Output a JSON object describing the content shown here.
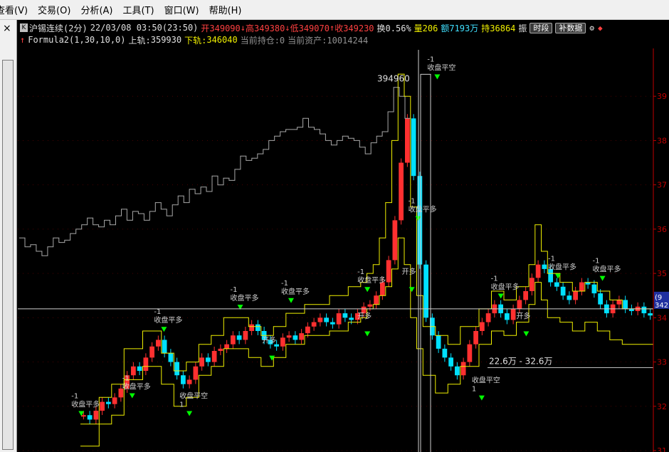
{
  "menu": [
    "查看(V)",
    "交易(O)",
    "分析(A)",
    "工具(T)",
    "窗口(W)",
    "帮助(H)"
  ],
  "left_panel": {
    "close_glyph": "×"
  },
  "info": {
    "badge": "K",
    "title": "沪锡连续(2分)",
    "datetime": "22/03/08 03:50(23:50)",
    "open": "开349090",
    "high": "高349380",
    "low": "低349070",
    "close": "收349230",
    "turnover": "换0.56%",
    "volume": "量206",
    "amount": "额7193万",
    "open_interest": "持36864",
    "amplitude": "振",
    "btn_timeframe": "时段",
    "btn_fill": "补数据"
  },
  "formula": {
    "name": "Formula2(1,30,10,0)",
    "upper_label": "上轨:",
    "upper_value": "359930",
    "lower_label": "下轨:",
    "lower_value": "346040",
    "position": "当前持仓:0",
    "assets": "当前资产:10014244"
  },
  "colors": {
    "up": "#ff3030",
    "down": "#00e0ff",
    "signal": "#00ff00",
    "band": "#f0f000",
    "price_line": "#a8a8a8",
    "axis": "#c00000"
  },
  "chart_data": {
    "type": "line",
    "ylim": [
      310000,
      400000
    ],
    "y_ticks": [
      {
        "value": 390000,
        "label": "39"
      },
      {
        "value": 380000,
        "label": "38"
      },
      {
        "value": 370000,
        "label": "37"
      },
      {
        "value": 360000,
        "label": "36"
      },
      {
        "value": 350000,
        "label": "35"
      },
      {
        "value": 340000,
        "label": "34"
      },
      {
        "value": 330000,
        "label": "33"
      },
      {
        "value": 320000,
        "label": "32"
      },
      {
        "value": 310000,
        "label": "31"
      }
    ],
    "peak_label": "394960",
    "cursor_tag": {
      "value": 342000,
      "top": "(9",
      "bottom": "342"
    },
    "volume_note": "22.6万 - 32.6万",
    "series": [
      {
        "values": [
          358000,
          356000,
          356500,
          355000,
          354000,
          356000,
          358000,
          357000,
          357500,
          359000,
          360000,
          361000,
          362500,
          361000,
          360500,
          362000,
          361000,
          363000,
          364500,
          362000,
          364000,
          363500,
          362000,
          364000,
          366000,
          364500,
          363000,
          365500,
          367500,
          366000,
          369000,
          368000,
          369500,
          368500,
          372000,
          370000,
          371500,
          371000,
          373500,
          376500,
          375500,
          376000,
          377000,
          378000,
          380000,
          381000,
          382000,
          382500,
          382500,
          383000,
          385000,
          383000,
          382500,
          381500,
          380000,
          379000,
          380000,
          381000,
          380500,
          380000,
          378500,
          377000,
          379500,
          381000,
          382000,
          386500,
          392000,
          390000,
          385000
        ]
      },
      {
        "values": [
          318000,
          317000,
          319000,
          321000,
          320500,
          322000,
          324000,
          327000,
          329000,
          328000,
          331000,
          333500,
          335000,
          332000,
          330000,
          327000,
          325000,
          326000,
          329000,
          331000,
          330000,
          332500,
          333000,
          334000,
          336000,
          335000,
          337000,
          338500,
          337000,
          335000,
          334000,
          333500,
          335500,
          336000,
          335000,
          336500,
          338000,
          339000,
          340000,
          339000,
          338500,
          341000,
          340000,
          339500,
          341000,
          342500,
          343000,
          345000,
          348000,
          353000,
          362000,
          375000,
          385000,
          372000,
          352000,
          340000,
          336000,
          333000,
          331000,
          329000,
          327000,
          330000,
          334000,
          337000,
          339000,
          341000,
          343000,
          341000,
          339500,
          342000,
          344000,
          346000,
          349000,
          352000,
          351000,
          348000,
          347000,
          345000,
          344000,
          346000,
          348000,
          347500,
          345500,
          343000,
          341000,
          343000,
          344000,
          342000,
          341500,
          342500,
          341000,
          340500
        ]
      },
      {
        "values": [
          316000,
          316000,
          316000,
          322000,
          322000,
          325000,
          325000,
          333000,
          333000,
          333000,
          337000,
          337000,
          337000,
          332000,
          332000,
          328000,
          328000,
          330000,
          330000,
          334000,
          334000,
          336000,
          336000,
          340000,
          340000,
          340000,
          340000,
          338000,
          338000,
          336000,
          336000,
          338000,
          338000,
          341000,
          341000,
          341000,
          343000,
          343000,
          343000,
          343000,
          345000,
          345000,
          345000,
          347000,
          347000,
          348000,
          350000,
          352000,
          358000,
          366000,
          380000,
          395000,
          390000,
          365000,
          345000,
          338000,
          338000,
          336000,
          336000,
          334000,
          334000,
          338000,
          338000,
          338000,
          342000,
          342000,
          346000,
          346000,
          344000,
          344000,
          347000,
          347000,
          352000,
          361000,
          355000,
          350000,
          350000,
          348000,
          348000,
          346000,
          346000,
          348000,
          348000,
          346000,
          346000,
          344000,
          344000,
          342000,
          342000,
          342000,
          342000,
          342000
        ]
      },
      {
        "values": [
          311000,
          311000,
          311000,
          316000,
          316000,
          318000,
          318000,
          326000,
          326000,
          326000,
          329000,
          329000,
          329000,
          325000,
          325000,
          320000,
          320000,
          322000,
          322000,
          327000,
          327000,
          329000,
          329000,
          333000,
          333000,
          333000,
          333000,
          331000,
          331000,
          329000,
          329000,
          331000,
          331000,
          334000,
          334000,
          334000,
          336000,
          336000,
          336000,
          336000,
          337000,
          337000,
          337000,
          339000,
          339000,
          340000,
          342000,
          343000,
          345000,
          347000,
          351000,
          358000,
          352000,
          340000,
          333000,
          327000,
          327000,
          323000,
          323000,
          325000,
          325000,
          329000,
          329000,
          329000,
          334000,
          334000,
          337000,
          337000,
          336000,
          336000,
          339000,
          339000,
          343000,
          348000,
          344000,
          340000,
          340000,
          339000,
          339000,
          337000,
          337000,
          339000,
          339000,
          337000,
          337000,
          335000,
          335000,
          334000,
          334000,
          334000,
          334000,
          334000
        ]
      }
    ],
    "signals": [
      {
        "x": 0.1,
        "value": 317000,
        "lines": [
          "-1",
          "收盘平多"
        ]
      },
      {
        "x": 0.18,
        "value": 321000,
        "lines": [
          "-1",
          "收盘平多"
        ]
      },
      {
        "x": 0.23,
        "value": 336000,
        "lines": [
          "-1",
          "收盘平多"
        ]
      },
      {
        "x": 0.35,
        "value": 341000,
        "lines": [
          "-1",
          "收盘平多"
        ]
      },
      {
        "x": 0.43,
        "value": 342500,
        "lines": [
          "-1",
          "收盘平多"
        ]
      },
      {
        "x": 0.55,
        "value": 345000,
        "lines": [
          "-1",
          "收盘平多"
        ]
      },
      {
        "x": 0.63,
        "value": 361000,
        "lines": [
          "-1",
          "收盘平多"
        ]
      },
      {
        "x": 0.66,
        "value": 393000,
        "lines": [
          "-1",
          "收盘平空"
        ]
      },
      {
        "x": 0.76,
        "value": 343500,
        "lines": [
          "-1",
          "收盘平多"
        ]
      },
      {
        "x": 0.85,
        "value": 348000,
        "lines": [
          "-1",
          "收盘平多"
        ]
      },
      {
        "x": 0.92,
        "value": 347500,
        "lines": [
          "-1",
          "收盘平多"
        ]
      },
      {
        "x": 0.27,
        "value": 317000,
        "lines": [
          "收盘平空",
          "1"
        ]
      },
      {
        "x": 0.4,
        "value": 329500,
        "lines": [
          "开多"
        ]
      },
      {
        "x": 0.55,
        "value": 335000,
        "lines": [
          "开多"
        ]
      },
      {
        "x": 0.62,
        "value": 345000,
        "lines": [
          "开多"
        ]
      },
      {
        "x": 0.73,
        "value": 320500,
        "lines": [
          "收盘平空",
          "1"
        ]
      },
      {
        "x": 0.8,
        "value": 335000,
        "lines": [
          "开多"
        ]
      }
    ]
  }
}
